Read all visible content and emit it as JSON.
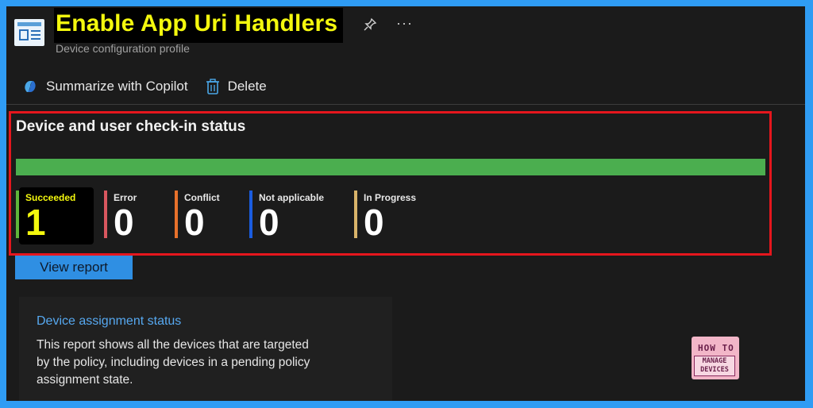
{
  "header": {
    "title": "Enable App Uri Handlers",
    "subtitle": "Device configuration profile",
    "more_label": "···"
  },
  "toolbar": {
    "copilot_label": "Summarize with Copilot",
    "delete_label": "Delete"
  },
  "checkin": {
    "title": "Device and user check-in status",
    "progress_percent": 100,
    "stats": [
      {
        "label": "Succeeded",
        "value": "1",
        "color": "#5fb63a"
      },
      {
        "label": "Error",
        "value": "0",
        "color": "#d9575f"
      },
      {
        "label": "Conflict",
        "value": "0",
        "color": "#e8712b"
      },
      {
        "label": "Not applicable",
        "value": "0",
        "color": "#1a5ce0"
      },
      {
        "label": "In Progress",
        "value": "0",
        "color": "#d9b46a"
      }
    ]
  },
  "view_report_label": "View report",
  "assignment": {
    "title": "Device assignment status",
    "description": "This report shows all the devices that are targeted by the policy, including devices in a pending policy assignment state."
  },
  "logo": {
    "line1": "HOW TO",
    "line2": "MANAGE",
    "line3": "DEVICES"
  },
  "colors": {
    "accent": "#2f8fe3",
    "highlight": "#f4f80e",
    "success": "#4bae4f",
    "callout": "#e5161d"
  }
}
